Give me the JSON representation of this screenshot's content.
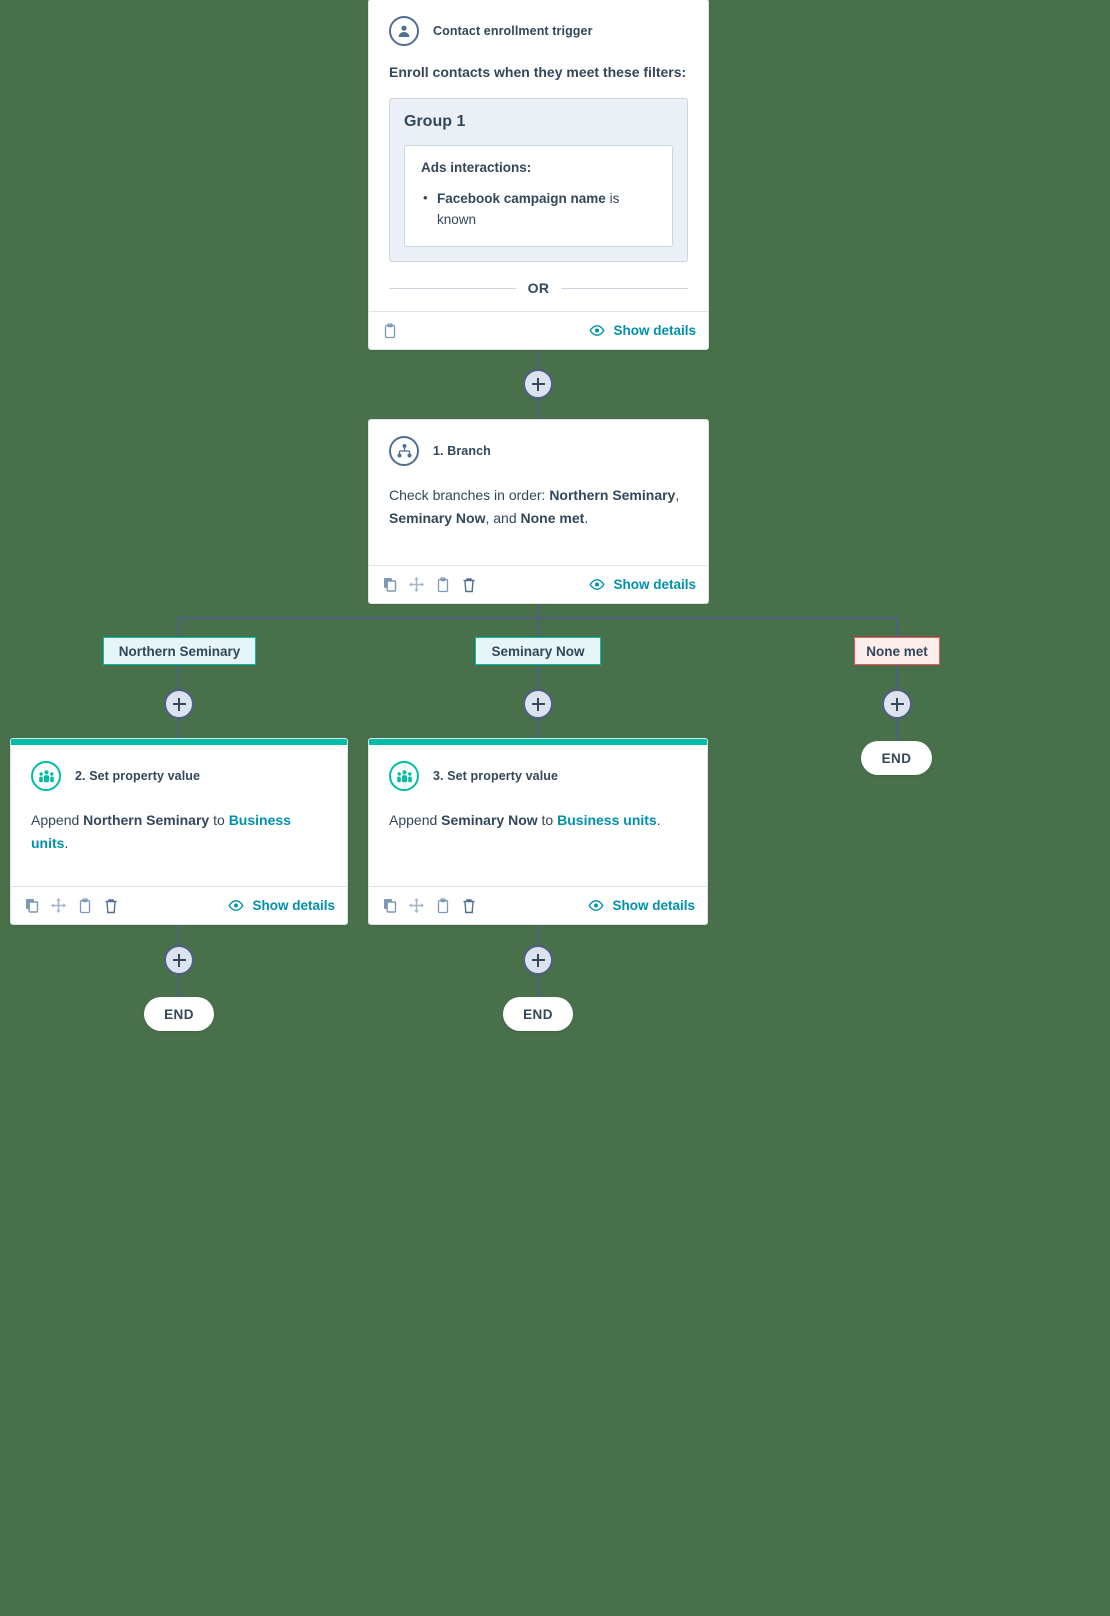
{
  "colors": {
    "canvas": "#48704b",
    "accent_teal": "#00bda5",
    "link_blue": "#0091ae",
    "text_navy": "#33475b",
    "connector": "#4e5f80",
    "branch_pill_bg": "#e5f5f8",
    "none_met_bg": "#fdeeec",
    "none_met_border": "#f2545b"
  },
  "trigger": {
    "icon": "contact-icon",
    "title": "Contact enrollment trigger",
    "lead": "Enroll contacts when they meet these filters:",
    "group": {
      "title": "Group 1",
      "filter_head": "Ads interactions:",
      "filter_bold": "Facebook campaign name",
      "filter_rest": " is known"
    },
    "or_label": "OR",
    "footer": {
      "icons": [
        "clipboard-icon"
      ],
      "show_details": "Show details"
    }
  },
  "branch_node": {
    "icon": "branch-icon",
    "title": "1. Branch",
    "desc_prefix": "Check branches in order: ",
    "desc_b1": "Northern Seminary",
    "desc_mid1": ", ",
    "desc_b2": "Seminary Now",
    "desc_mid2": ", and ",
    "desc_b3": "None met",
    "desc_suffix": ".",
    "footer": {
      "icons": [
        "copy-icon",
        "move-icon",
        "clipboard-icon",
        "trash-icon"
      ],
      "show_details": "Show details"
    }
  },
  "branches": [
    {
      "label": "Northern Seminary",
      "type": "match"
    },
    {
      "label": "Seminary Now",
      "type": "match"
    },
    {
      "label": "None met",
      "type": "none"
    }
  ],
  "actions": [
    {
      "icon": "set-property-icon",
      "title": "2. Set property value",
      "desc_prefix": "Append ",
      "desc_bold": "Northern Seminary",
      "desc_mid": " to ",
      "desc_link": "Business units",
      "desc_suffix": ".",
      "footer": {
        "icons": [
          "copy-icon",
          "move-icon",
          "clipboard-icon",
          "trash-icon"
        ],
        "show_details": "Show details"
      }
    },
    {
      "icon": "set-property-icon",
      "title": "3. Set property value",
      "desc_prefix": "Append ",
      "desc_bold": "Seminary Now",
      "desc_mid": " to ",
      "desc_link": "Business units",
      "desc_suffix": ".",
      "footer": {
        "icons": [
          "copy-icon",
          "move-icon",
          "clipboard-icon",
          "trash-icon"
        ],
        "show_details": "Show details"
      }
    }
  ],
  "end_nodes": [
    {
      "label": "END"
    },
    {
      "label": "END"
    },
    {
      "label": "END"
    }
  ],
  "add_buttons": [
    {
      "name": "add-step-after-trigger"
    },
    {
      "name": "add-step-branch-1"
    },
    {
      "name": "add-step-branch-2"
    },
    {
      "name": "add-step-branch-3"
    },
    {
      "name": "add-step-after-action-2"
    },
    {
      "name": "add-step-after-action-3"
    }
  ]
}
